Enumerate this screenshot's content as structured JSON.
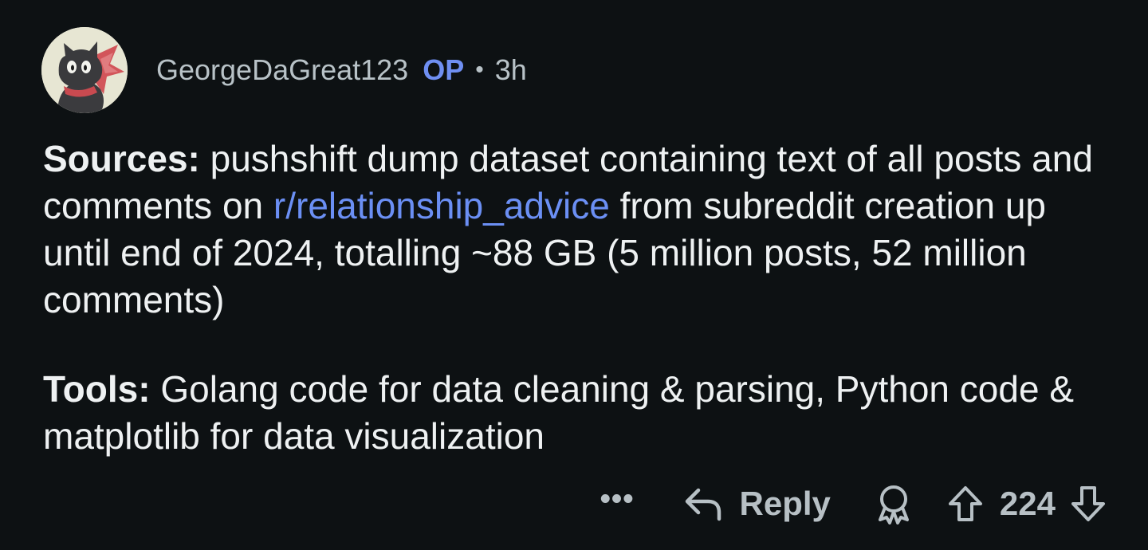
{
  "comment": {
    "author": "GeorgeDaGreat123",
    "op_badge": "OP",
    "separator": "•",
    "time": "3h",
    "paragraphs": {
      "sources": {
        "label": "Sources:",
        "text_before_link": " pushshift dump dataset containing text of all posts and comments on ",
        "link": "r/relationship_advice",
        "text_after_link": " from subreddit creation up until end of 2024, totalling ~88 GB (5 million posts, 52 million comments)"
      },
      "tools": {
        "label": "Tools:",
        "text": " Golang code for data cleaning & parsing, Python code & matplotlib for data visualization"
      }
    },
    "actions": {
      "more": "•••",
      "reply": "Reply",
      "score": "224"
    },
    "icons": {
      "avatar": "cat-avatar",
      "more": "more-options-icon",
      "reply": "reply-arrow-icon",
      "award": "award-icon",
      "upvote": "upvote-arrow-icon",
      "downvote": "downvote-arrow-icon"
    },
    "colors": {
      "background": "#0d1113",
      "text": "#eef1f2",
      "muted": "#b8c2c7",
      "accent": "#6f8ff2"
    }
  }
}
